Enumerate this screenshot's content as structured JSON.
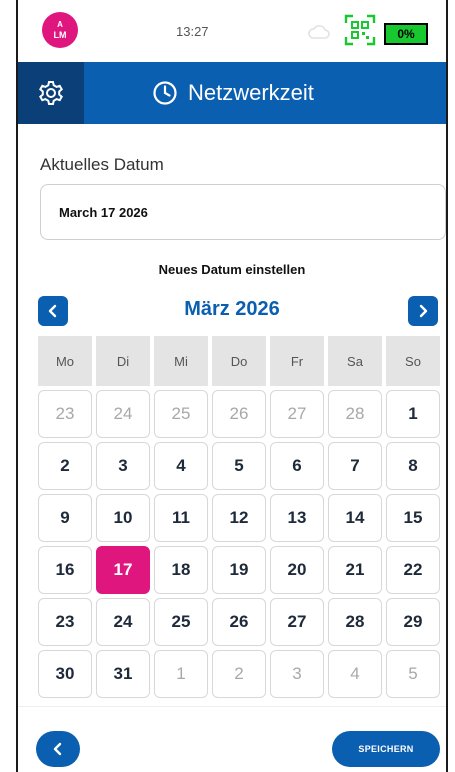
{
  "status": {
    "avatar_top": "A",
    "avatar_initials": "LM",
    "time": "13:27",
    "battery": "0%",
    "icons": [
      "cloud-icon",
      "qr-code-icon",
      "battery-icon"
    ]
  },
  "header": {
    "title": "Netzwerkzeit",
    "icons": [
      "gear-icon",
      "clock-icon"
    ]
  },
  "current": {
    "label": "Aktuelles Datum",
    "value": "March 17 2026"
  },
  "calendar": {
    "heading": "Neues Datum einstellen",
    "month_title": "März 2026",
    "weekdays": [
      "Mo",
      "Di",
      "Mi",
      "Do",
      "Fr",
      "Sa",
      "So"
    ],
    "days": [
      {
        "label": "23",
        "muted": true
      },
      {
        "label": "24",
        "muted": true
      },
      {
        "label": "25",
        "muted": true
      },
      {
        "label": "26",
        "muted": true
      },
      {
        "label": "27",
        "muted": true
      },
      {
        "label": "28",
        "muted": true
      },
      {
        "label": "1"
      },
      {
        "label": "2"
      },
      {
        "label": "3"
      },
      {
        "label": "4"
      },
      {
        "label": "5"
      },
      {
        "label": "6"
      },
      {
        "label": "7"
      },
      {
        "label": "8"
      },
      {
        "label": "9"
      },
      {
        "label": "10"
      },
      {
        "label": "11"
      },
      {
        "label": "12"
      },
      {
        "label": "13"
      },
      {
        "label": "14"
      },
      {
        "label": "15"
      },
      {
        "label": "16"
      },
      {
        "label": "17",
        "selected": true
      },
      {
        "label": "18"
      },
      {
        "label": "19"
      },
      {
        "label": "20"
      },
      {
        "label": "21"
      },
      {
        "label": "22"
      },
      {
        "label": "23"
      },
      {
        "label": "24"
      },
      {
        "label": "25"
      },
      {
        "label": "26"
      },
      {
        "label": "27"
      },
      {
        "label": "28"
      },
      {
        "label": "29"
      },
      {
        "label": "30"
      },
      {
        "label": "31"
      },
      {
        "label": "1",
        "muted": true
      },
      {
        "label": "2",
        "muted": true
      },
      {
        "label": "3",
        "muted": true
      },
      {
        "label": "4",
        "muted": true
      },
      {
        "label": "5",
        "muted": true
      }
    ]
  },
  "footer": {
    "save_label": "SPEICHERN"
  },
  "colors": {
    "primary": "#0b5fb0",
    "primary_dark": "#0a3f78",
    "accent": "#e0167f",
    "battery": "#17c82e"
  }
}
